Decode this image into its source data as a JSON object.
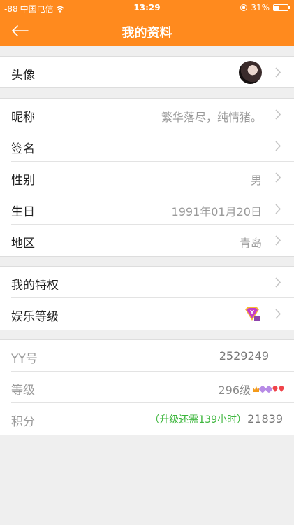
{
  "status_bar": {
    "signal": "-88",
    "carrier": "中国电信",
    "time": "13:29",
    "battery": "31%",
    "battery_level": 0.31
  },
  "nav": {
    "title": "我的资料",
    "back_icon": "arrow-left-icon"
  },
  "profile": {
    "avatar_label": "头像",
    "nickname_label": "昵称",
    "nickname_value": "繁华落尽，纯情猪。",
    "signature_label": "签名",
    "signature_value": "",
    "gender_label": "性别",
    "gender_value": "男",
    "birthday_label": "生日",
    "birthday_value": "1991年01月20日",
    "region_label": "地区",
    "region_value": "青岛"
  },
  "privileges": {
    "my_privilege_label": "我的特权",
    "entertainment_level_label": "娱乐等级",
    "entertainment_badge_icon": "yy-badge-icon"
  },
  "info": {
    "yy_label": "YY号",
    "yy_value": "2529249",
    "level_label": "等级",
    "level_value": "296级",
    "level_icons": [
      "crown-icon",
      "purple-diamond-icon",
      "purple-diamond-icon",
      "red-heart-icon",
      "red-heart-icon"
    ],
    "points_label": "积分",
    "upgrade_text": "（升级还需139小时）",
    "points_value": "21839"
  },
  "colors": {
    "accent": "#ff8a1e",
    "upgrade": "#3cb63c"
  }
}
